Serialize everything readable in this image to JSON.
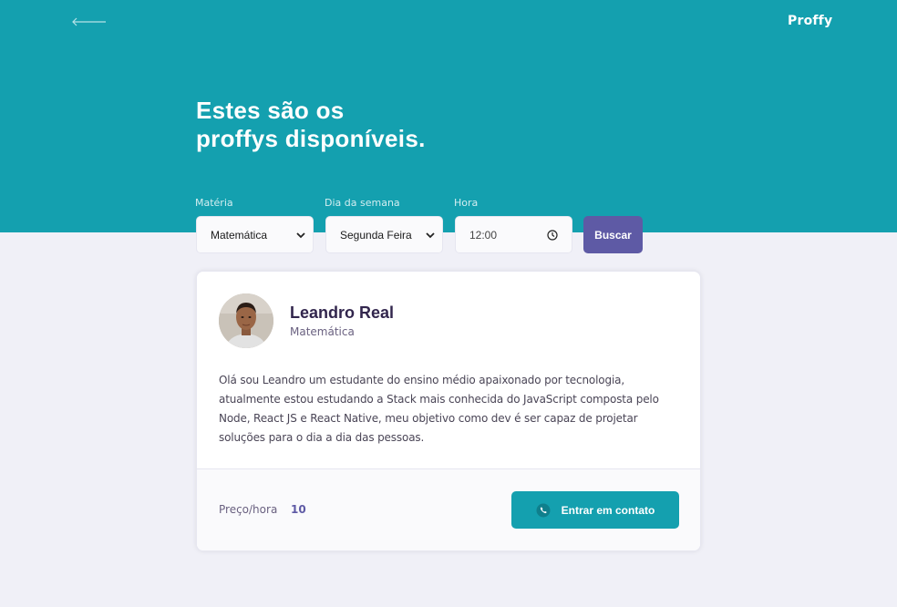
{
  "header": {
    "logo": "Proffy",
    "back_icon": "arrow-left-icon"
  },
  "hero": {
    "title_line1": "Estes são os",
    "title_line2": "proffys disponíveis."
  },
  "search": {
    "subject_label": "Matéria",
    "subject_value": "Matemática",
    "weekday_label": "Dia da semana",
    "weekday_value": "Segunda Feira",
    "time_label": "Hora",
    "time_value": "12:00",
    "button_label": "Buscar"
  },
  "teacher": {
    "name": "Leandro Real",
    "subject": "Matemática",
    "bio": "Olá sou Leandro um estudante do ensino médio apaixonado por tecnologia, atualmente estou estudando a Stack mais conhecida do JavaScript composta pelo Node, React JS e React Native, meu objetivo como dev é ser capaz de projetar soluções para o dia a dia das pessoas.",
    "price_label": "Preço/hora",
    "price_value": "10",
    "contact_label": "Entrar em contato"
  },
  "colors": {
    "primary": "#14a0af",
    "secondary": "#5e5aa5",
    "background": "#f0f0f7",
    "title_text": "#32264d"
  }
}
